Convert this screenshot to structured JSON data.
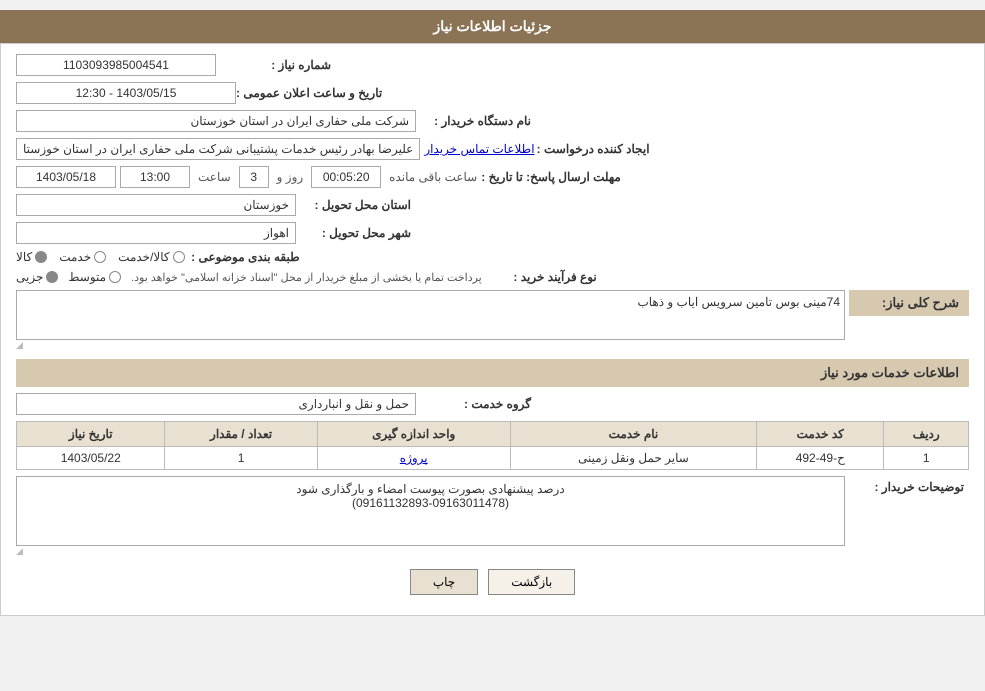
{
  "page": {
    "title": "جزئیات اطلاعات نیاز"
  },
  "header": {
    "label": "جزئیات اطلاعات نیاز"
  },
  "fields": {
    "shmara_niaz_label": "شماره نیاز :",
    "shmara_niaz_value": "1103093985004541",
    "nam_dastgah_label": "نام دستگاه خریدار :",
    "nam_dastgah_value": "شرکت ملی حفاری ایران در استان خوزستان",
    "ijad_konande_label": "ایجاد کننده درخواست :",
    "ijad_konande_value": "علیرضا بهادر رئیس خدمات پشتیبانی شرکت ملی حفاری ایران در استان خوزستا",
    "etelaat_tamas": "اطلاعات تماس خریدار",
    "mohlat_label": "مهلت ارسال پاسخ: تا تاریخ :",
    "mohlat_date": "1403/05/18",
    "mohlat_saat_label": "ساعت",
    "mohlat_saat": "13:00",
    "mohlat_roz_label": "روز و",
    "mohlat_roz": "3",
    "mohlat_mande_label": "ساعت باقی مانده",
    "mohlat_mande": "00:05:20",
    "ostan_tahvil_label": "استان محل تحویل :",
    "ostan_tahvil_value": "خوزستان",
    "shahr_tahvil_label": "شهر محل تحویل :",
    "shahr_tahvil_value": "اهواز",
    "tabaqe_label": "طبقه بندی موضوعی :",
    "tabaqe_kala": "کالا",
    "tabaqe_khadamat": "خدمت",
    "tabaqe_kala_khadamat": "کالا/خدمت",
    "tabaqe_selected": "kala",
    "noe_farayand_label": "نوع فرآیند خرید :",
    "noe_jozi": "جزیی",
    "noe_mottaset": "متوسط",
    "noe_farayand_desc": "پرداخت تمام یا بخشی از مبلغ خریدار از محل \"اسناد خزانه اسلامی\" خواهد بود.",
    "tarikh_saat_label": "تاریخ و ساعت اعلان عمومی :",
    "tarikh_saat_value": "1403/05/15 - 12:30",
    "sharh_niaz_section": "شرح کلی نیاز:",
    "sharh_niaz_value": "74مینی بوس تامین سرویس ایاب و ذهاب",
    "etelaat_khadamat_section": "اطلاعات خدمات مورد نیاز",
    "grohe_khadamat_label": "گروه خدمت :",
    "grohe_khadamat_value": "حمل و نقل و انبارداری",
    "table": {
      "headers": [
        "ردیف",
        "کد خدمت",
        "نام خدمت",
        "واحد اندازه گیری",
        "تعداد / مقدار",
        "تاریخ نیاز"
      ],
      "rows": [
        {
          "radif": "1",
          "kod_khadamat": "ح-49-492",
          "nam_khadamat": "سایر حمل ونقل زمینی",
          "vahed": "پروژه",
          "tedad": "1",
          "tarikh": "1403/05/22"
        }
      ]
    },
    "tozihat_label": "توضیحات خریدار :",
    "tozihat_value": "درصد پیشنهادی بصورت پیوست امضاء و بارگذاری شود\n(09161132893-09163011478)",
    "btn_back": "بازگشت",
    "btn_print": "چاپ"
  }
}
